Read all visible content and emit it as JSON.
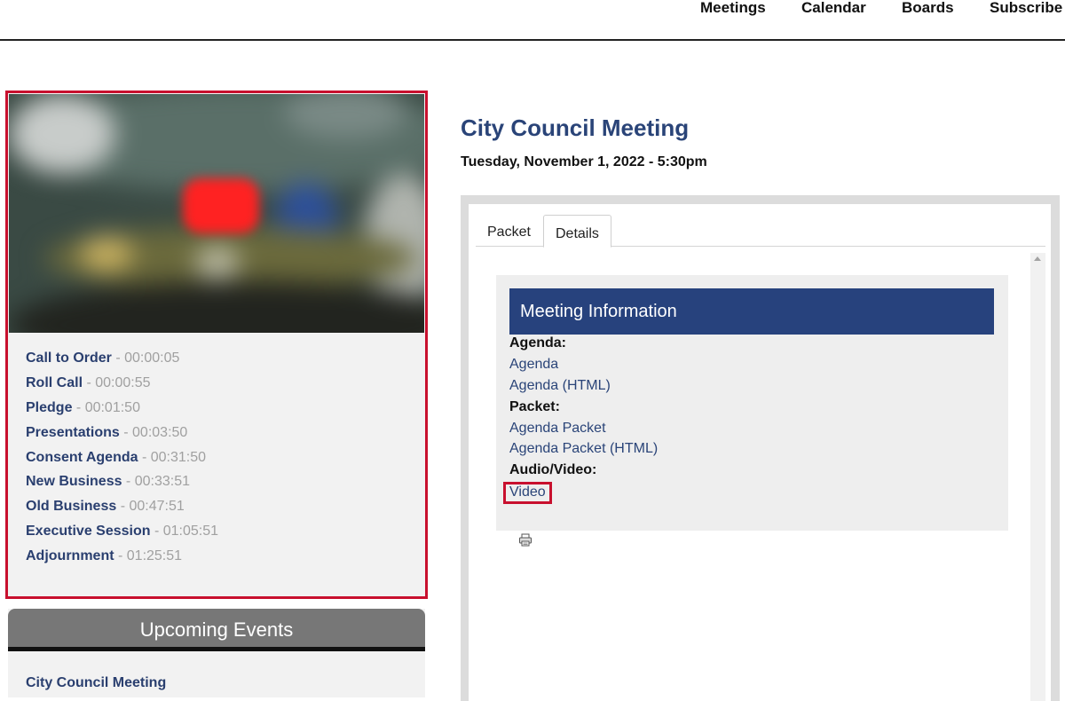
{
  "nav": {
    "items": [
      {
        "label": "Meetings"
      },
      {
        "label": "Calendar"
      },
      {
        "label": "Boards"
      },
      {
        "label": "Subscribe"
      }
    ]
  },
  "video": {
    "chapters": [
      {
        "label": "Call to Order",
        "time": " - 00:00:05"
      },
      {
        "label": "Roll Call",
        "time": " - 00:00:55"
      },
      {
        "label": "Pledge",
        "time": " - 00:01:50"
      },
      {
        "label": "Presentations",
        "time": " - 00:03:50"
      },
      {
        "label": "Consent Agenda",
        "time": " - 00:31:50"
      },
      {
        "label": "New Business",
        "time": " - 00:33:51"
      },
      {
        "label": "Old Business",
        "time": " - 00:47:51"
      },
      {
        "label": "Executive Session",
        "time": " - 01:05:51"
      },
      {
        "label": "Adjournment",
        "time": " - 01:25:51"
      }
    ]
  },
  "upcoming": {
    "title": "Upcoming Events",
    "items": [
      "City Council Meeting"
    ]
  },
  "meeting": {
    "title": "City Council Meeting",
    "date": "Tuesday, November 1, 2022 - 5:30pm"
  },
  "tabs": [
    {
      "label": "Packet",
      "active": false
    },
    {
      "label": "Details",
      "active": true
    }
  ],
  "info": {
    "heading": "Meeting Information",
    "agenda_label": "Agenda:",
    "agenda_link": "Agenda",
    "agenda_html_link": "Agenda (HTML)",
    "packet_label": "Packet:",
    "packet_link": "Agenda Packet",
    "packet_html_link": "Agenda Packet (HTML)",
    "av_label": "Audio/Video:",
    "video_link": "Video"
  },
  "colors": {
    "accent_red": "#c8102e",
    "brand_navy": "#27427d",
    "link": "#2a4478"
  },
  "icons": {
    "print": "printer-icon",
    "scroll": "scroll-up-arrow-icon"
  }
}
